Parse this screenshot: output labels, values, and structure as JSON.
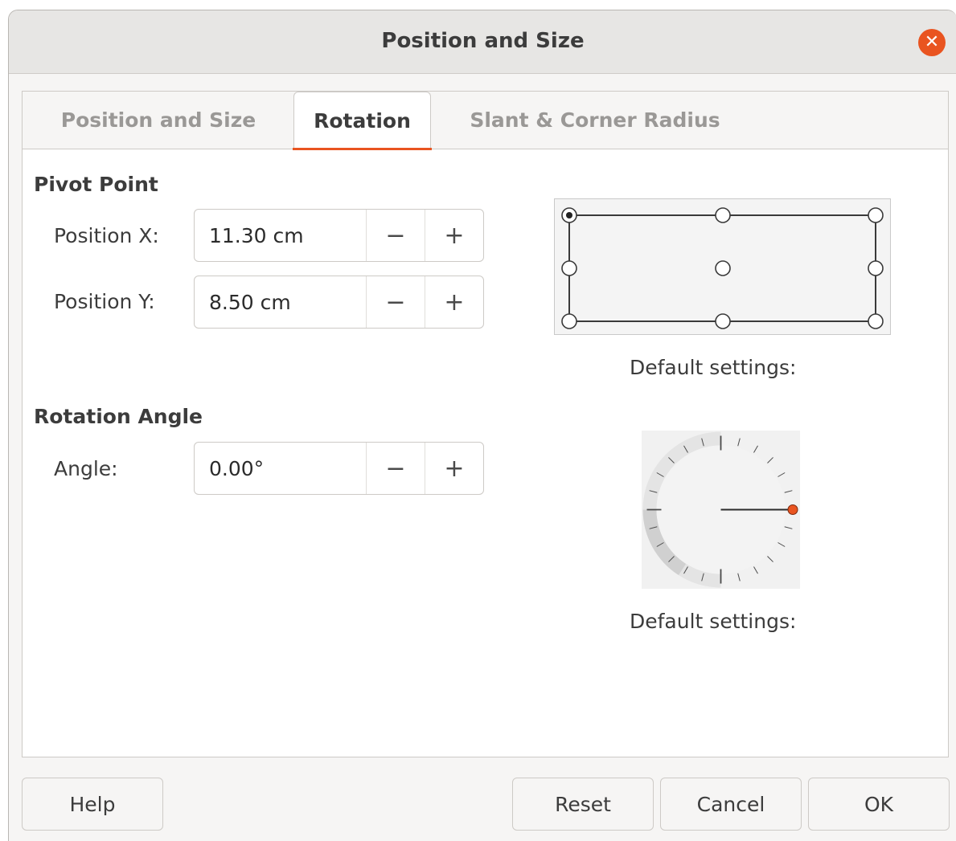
{
  "window": {
    "title": "Position and Size",
    "close_icon": "close-icon"
  },
  "tabs": [
    {
      "label": "Position and Size",
      "active": false
    },
    {
      "label": "Rotation",
      "active": true
    },
    {
      "label": "Slant & Corner Radius",
      "active": false
    }
  ],
  "pivot_point": {
    "heading": "Pivot Point",
    "position_x": {
      "label": "Position X:",
      "value": "11.30 cm"
    },
    "position_y": {
      "label": "Position Y:",
      "value": "8.50 cm"
    },
    "selected_point": "top-left",
    "caption": "Default settings:"
  },
  "rotation_angle": {
    "heading": "Rotation Angle",
    "angle": {
      "label": "Angle:",
      "value": "0.00°"
    },
    "dial_angle_degrees": 0,
    "caption": "Default settings:"
  },
  "spin_buttons": {
    "minus": "−",
    "plus": "+"
  },
  "buttons": {
    "help": "Help",
    "reset": "Reset",
    "cancel": "Cancel",
    "ok": "OK"
  },
  "colors": {
    "accent": "#e95420",
    "dial_marker": "#e95420"
  }
}
